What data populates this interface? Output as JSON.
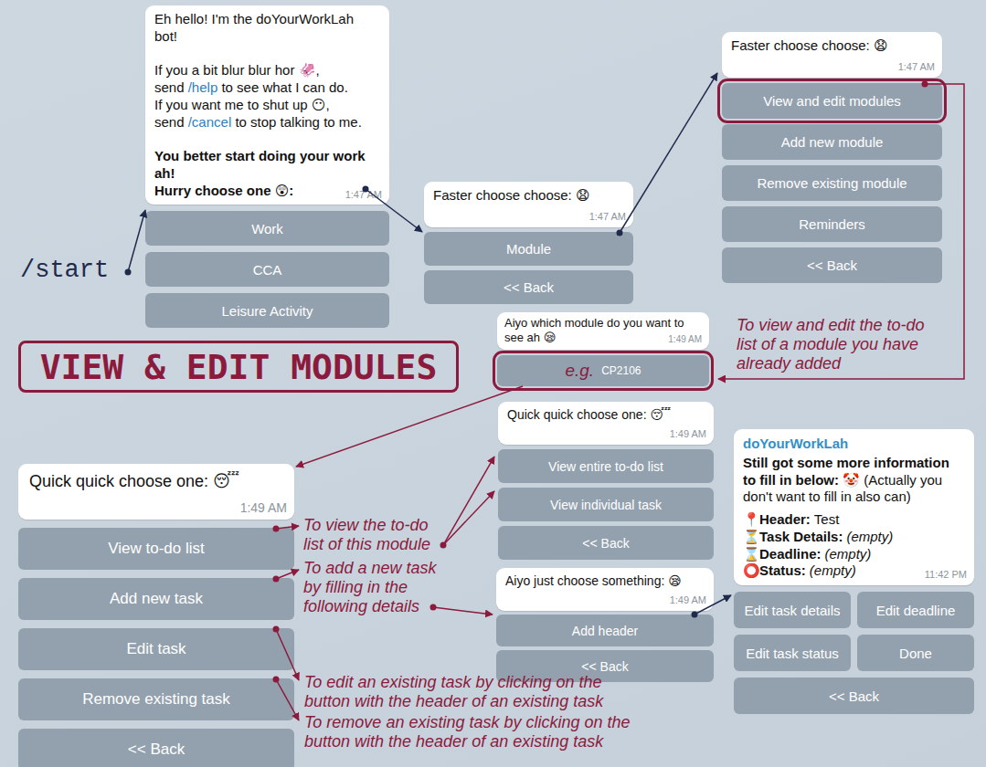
{
  "start_label": "/start",
  "title": "VIEW & EDIT MODULES",
  "chats": {
    "start_menu": {
      "lines": [
        [
          {
            "text": "Eh hello! I'm the doYourWorkLah bot!",
            "style": "plain"
          }
        ],
        [],
        [
          {
            "text": "If you a bit blur blur hor 🦑,",
            "style": "plain"
          }
        ],
        [
          {
            "text": "send ",
            "style": "plain"
          },
          {
            "text": "/help",
            "style": "command"
          },
          {
            "text": " to see what I can do.",
            "style": "plain"
          }
        ],
        [
          {
            "text": "If you want me to shut up 😶,",
            "style": "plain"
          }
        ],
        [
          {
            "text": "send ",
            "style": "plain"
          },
          {
            "text": "/cancel",
            "style": "command"
          },
          {
            "text": " to stop talking to me.",
            "style": "plain"
          }
        ],
        [],
        [
          {
            "text": "You better start doing your work ah!",
            "style": "bold"
          }
        ],
        [
          {
            "text": "Hurry choose one 😲:",
            "style": "bold"
          }
        ]
      ],
      "time": "1:47 AM",
      "buttons": [
        {
          "label": "Work",
          "kind": "plain",
          "highlighted": false
        },
        {
          "label": "CCA",
          "kind": "plain",
          "highlighted": false
        },
        {
          "label": "Leisure Activity",
          "kind": "plain",
          "highlighted": false
        }
      ]
    },
    "work_menu": {
      "lines": [
        [
          {
            "text": "Faster choose choose: 😧",
            "style": "plain"
          }
        ]
      ],
      "time": "1:47 AM",
      "buttons": [
        {
          "label": "Module",
          "kind": "plain",
          "highlighted": false
        },
        {
          "label": "<< Back",
          "kind": "plain",
          "highlighted": false
        }
      ]
    },
    "module_menu": {
      "lines": [
        [
          {
            "text": "Faster choose choose: 😧",
            "style": "plain"
          }
        ]
      ],
      "time": "1:47 AM",
      "buttons": [
        {
          "label": "View and edit modules",
          "kind": "plain",
          "highlighted": true
        },
        {
          "label": "Add new module",
          "kind": "plain",
          "highlighted": false
        },
        {
          "label": "Remove existing module",
          "kind": "plain",
          "highlighted": false
        },
        {
          "label": "Reminders",
          "kind": "plain",
          "highlighted": false
        },
        {
          "label": "<< Back",
          "kind": "plain",
          "highlighted": false
        }
      ]
    },
    "module_picker": {
      "lines": [
        [
          {
            "text": "Aiyo which module do you want to see ah 😪",
            "style": "plain"
          }
        ]
      ],
      "time": "1:49 AM",
      "buttons": [
        {
          "label": "CP2106",
          "hint": "e.g.",
          "kind": "example",
          "highlighted": true
        }
      ]
    },
    "module_actions": {
      "lines": [
        [
          {
            "text": "Quick quick choose one: 😴",
            "style": "plain"
          }
        ]
      ],
      "time": "1:49 AM",
      "buttons": [
        {
          "label": "View to-do list",
          "kind": "plain",
          "highlighted": false
        },
        {
          "label": "Add new task",
          "kind": "plain",
          "highlighted": false
        },
        {
          "label": "Edit task",
          "kind": "plain",
          "highlighted": false
        },
        {
          "label": "Remove existing task",
          "kind": "plain",
          "highlighted": false
        },
        {
          "label": "<< Back",
          "kind": "plain",
          "highlighted": false
        }
      ]
    },
    "todo_menu": {
      "lines": [
        [
          {
            "text": "Quick quick choose one: 😴",
            "style": "plain"
          }
        ]
      ],
      "time": "1:49 AM",
      "buttons": [
        {
          "label": "View entire to-do list",
          "kind": "plain",
          "highlighted": false
        },
        {
          "label": "View individual task",
          "kind": "plain",
          "highlighted": false
        },
        {
          "label": "<< Back",
          "kind": "plain",
          "highlighted": false
        }
      ]
    },
    "add_task_menu": {
      "lines": [
        [
          {
            "text": "Aiyo just choose something: 😪",
            "style": "plain"
          }
        ]
      ],
      "time": "1:49 AM",
      "buttons": [
        {
          "label": "Add header",
          "kind": "plain",
          "highlighted": false
        },
        {
          "label": "<< Back",
          "kind": "plain",
          "highlighted": false
        }
      ]
    }
  },
  "task_card": {
    "sender": "doYourWorkLah",
    "intro": [
      {
        "text": "Still got some more information to fill in below: 🤡",
        "style": "bold"
      },
      {
        "text": " (Actually you don't want to fill in also can)",
        "style": "plain"
      }
    ],
    "fields": [
      {
        "icon": "📍",
        "label": "Header:",
        "value": "Test",
        "empty": false
      },
      {
        "icon": "⏳",
        "label": "Task Details:",
        "value": "(empty)",
        "empty": true
      },
      {
        "icon": "⌛",
        "label": "Deadline:",
        "value": "(empty)",
        "empty": true
      },
      {
        "icon": "⭕",
        "label": "Status:",
        "value": "(empty)",
        "empty": true
      }
    ],
    "time": "11:42 PM",
    "button_rows": [
      [
        {
          "label": "Edit task details"
        },
        {
          "label": "Edit deadline"
        }
      ],
      [
        {
          "label": "Edit task status"
        },
        {
          "label": "Done"
        }
      ],
      [
        {
          "label": "<< Back"
        }
      ]
    ]
  },
  "notes": {
    "edit_modules": {
      "lines": [
        "To view and edit the to-do",
        "list of a module you have",
        "already added"
      ]
    },
    "view_list": {
      "lines": [
        "To view the to-do",
        "list of this module"
      ]
    },
    "add_task": {
      "lines": [
        "To add a new task",
        "by filling in the",
        "following details"
      ]
    },
    "edit_task": {
      "lines": [
        "To edit an existing task by clicking on the",
        "button with the header of an existing task"
      ]
    },
    "remove_task": {
      "lines": [
        "To remove an existing task by clicking on the",
        "button with the header of an existing task"
      ]
    }
  }
}
